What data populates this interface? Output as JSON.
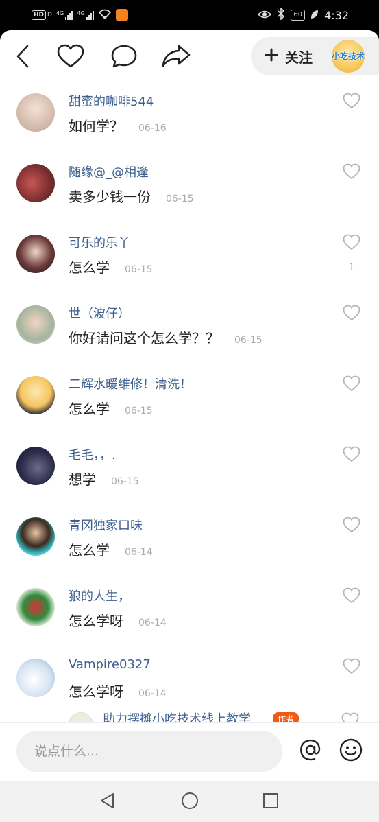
{
  "status_bar": {
    "hd_label": "HD",
    "sim_label": "D",
    "network1": "4G",
    "network2": "4G",
    "battery": "60",
    "time": "4:32"
  },
  "toolbar": {
    "follow_label": "关注",
    "account_avatar_text": "小吃技术"
  },
  "comments": [
    {
      "user": "甜蜜的咖啡544",
      "text": "如何学？",
      "date": "06-16",
      "likes": ""
    },
    {
      "user": "随缘@_@相逢",
      "text": "卖多少钱一份",
      "date": "06-15",
      "likes": ""
    },
    {
      "user": "可乐的乐丫",
      "text": "怎么学",
      "date": "06-15",
      "likes": "1"
    },
    {
      "user": "世（波仔）",
      "text": "你好请问这个怎么学？？",
      "date": "06-15",
      "likes": ""
    },
    {
      "user": "二辉水暖维修！清洗！",
      "text": "怎么学",
      "date": "06-15",
      "likes": ""
    },
    {
      "user": "毛毛，，.",
      "text": "想学",
      "date": "06-15",
      "likes": ""
    },
    {
      "user": "青冈独家口味",
      "text": "怎么学",
      "date": "06-14",
      "likes": ""
    },
    {
      "user": "狼的人生，",
      "text": "怎么学呀",
      "date": "06-14",
      "likes": ""
    },
    {
      "user": "Vampire0327",
      "text": "怎么学呀",
      "date": "06-14",
      "likes": ""
    }
  ],
  "partial_reply": {
    "user": "助力摆摊小吃技术线上教学",
    "badge": "作者"
  },
  "input": {
    "placeholder": "说点什么..."
  },
  "colors": {
    "username": "#3d5f8e",
    "author_badge": "#f05a14",
    "date": "#aaaaaa"
  },
  "icons": [
    "back-icon",
    "heart-icon",
    "comment-icon",
    "share-icon",
    "plus-icon",
    "at-icon",
    "emoji-icon",
    "nav-back-icon",
    "nav-home-icon",
    "nav-recents-icon"
  ]
}
